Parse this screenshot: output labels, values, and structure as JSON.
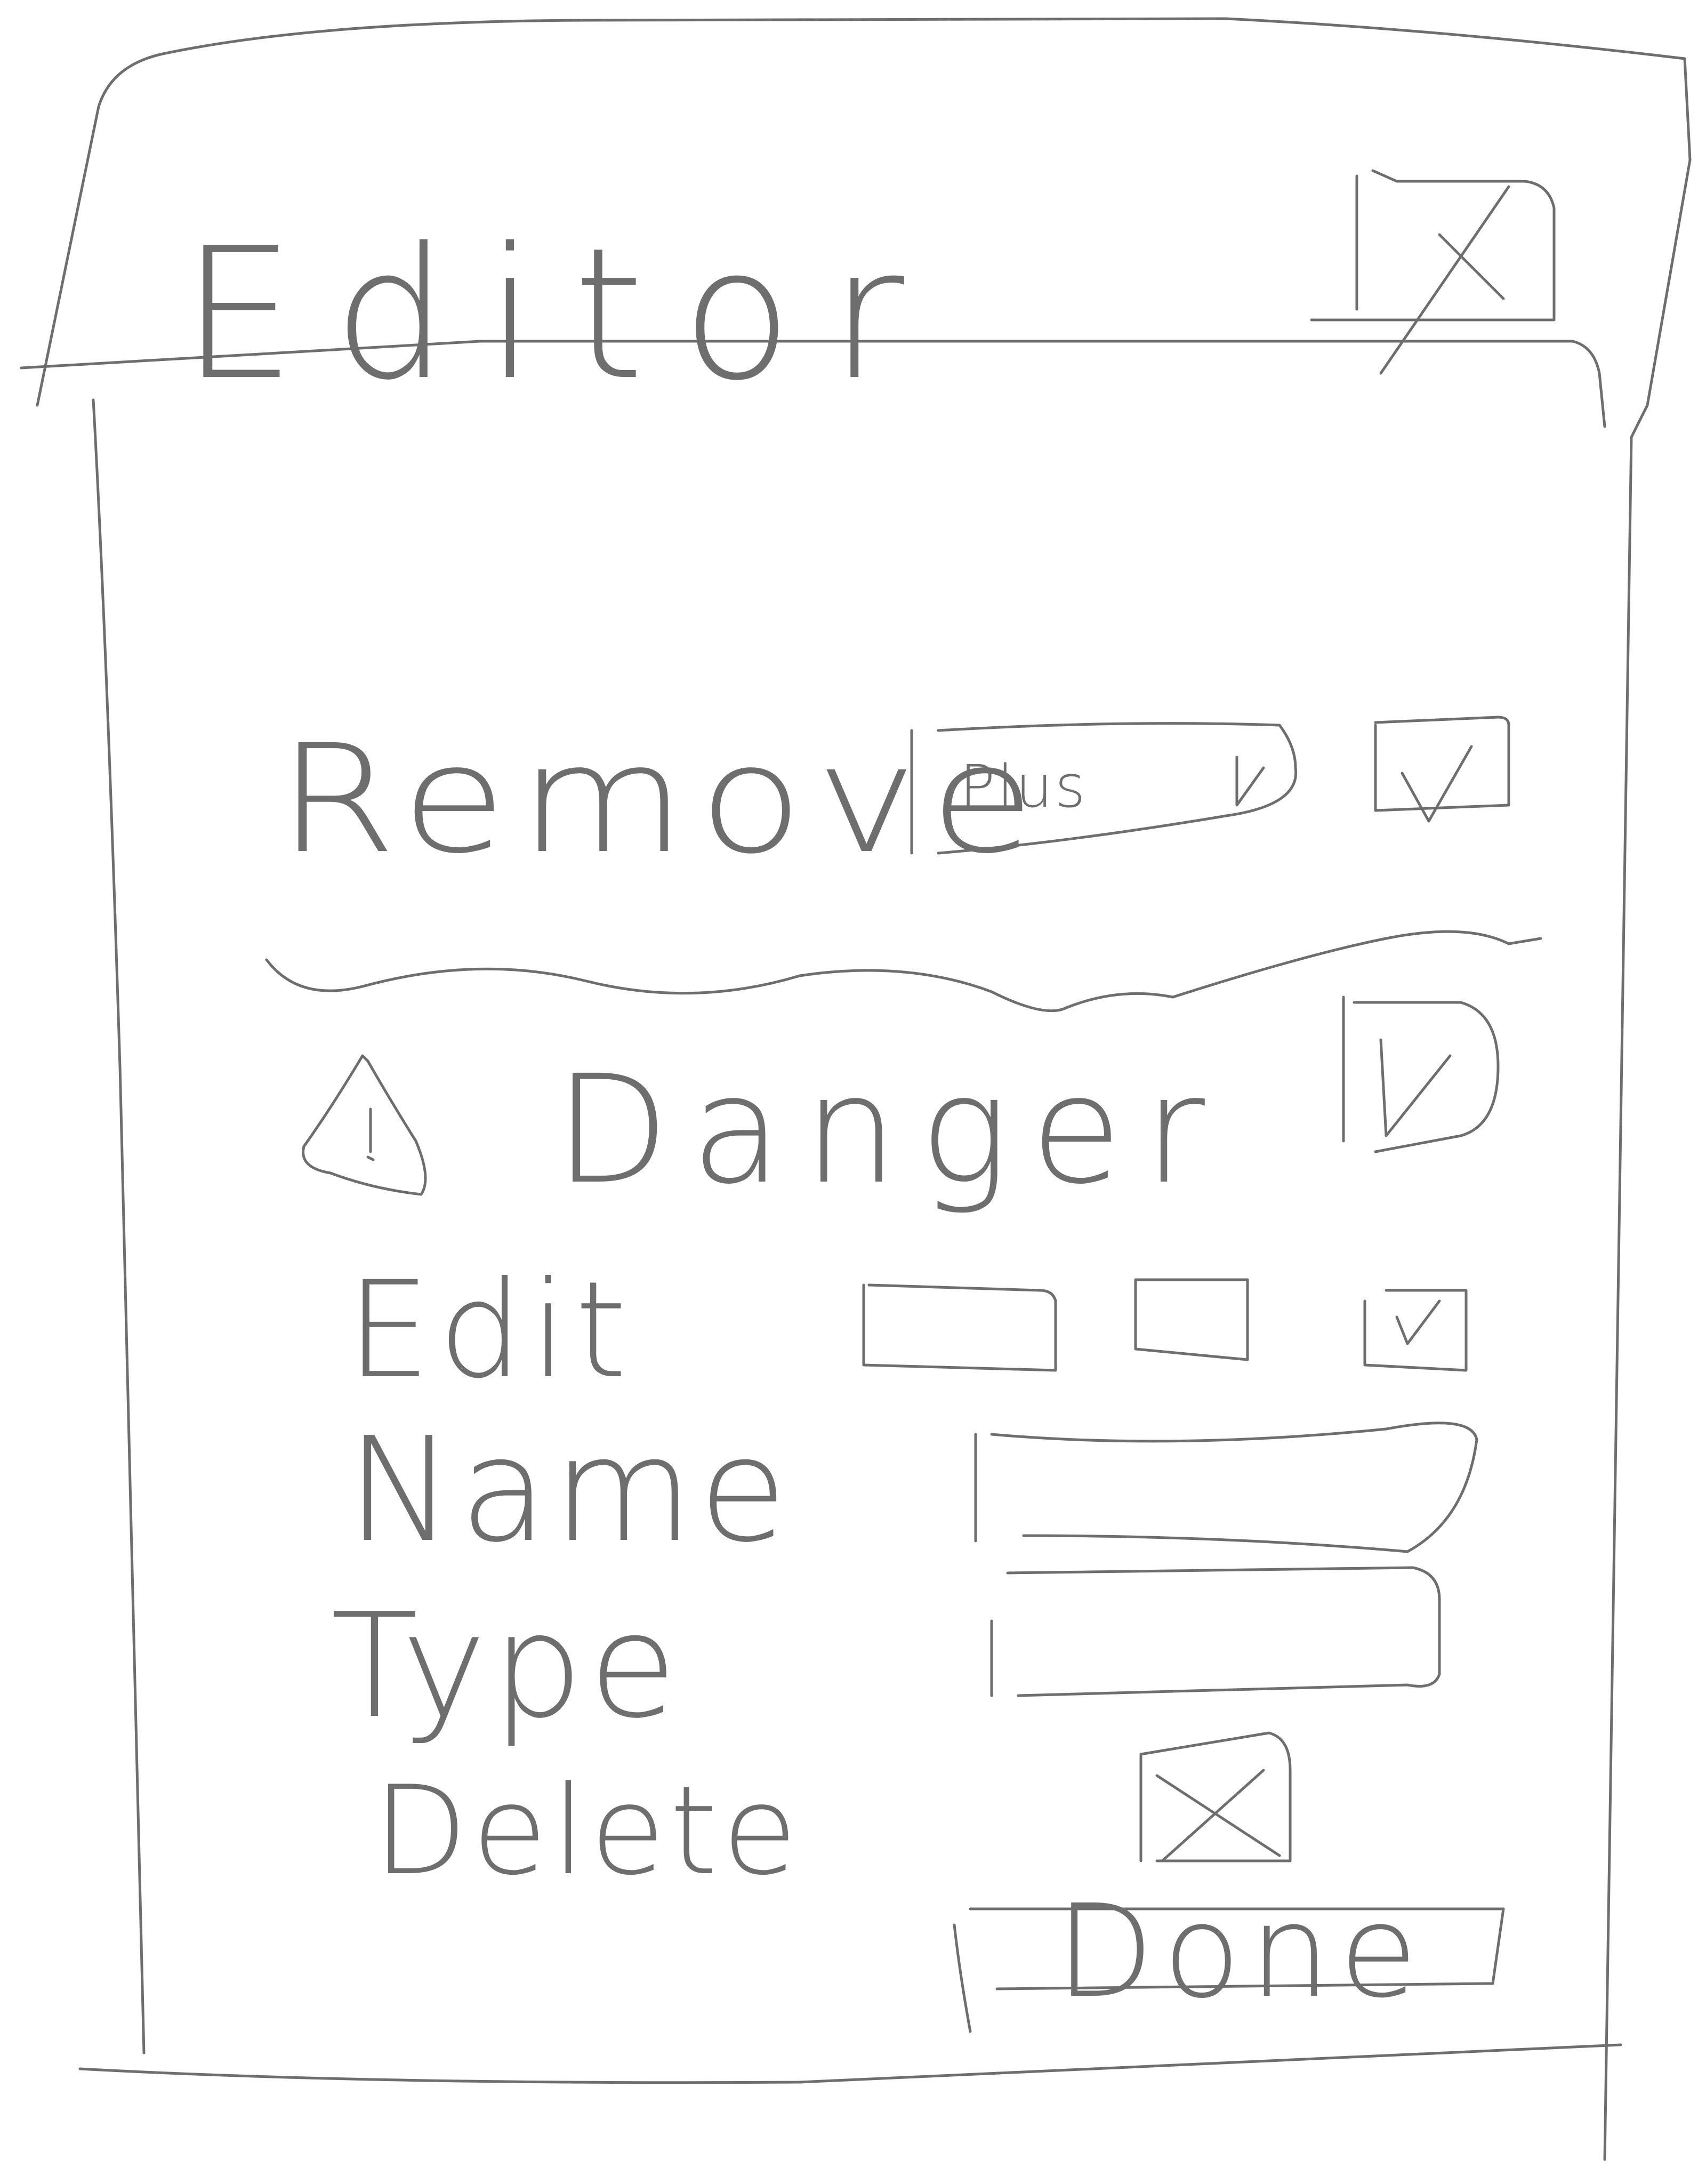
{
  "dialog": {
    "title": "Editor",
    "close_icon": "close-x-icon"
  },
  "remove_row": {
    "label": "Remove",
    "dropdown_value": "Plus",
    "dropdown_icon": "chevron-down-icon",
    "checkbox_checked": true
  },
  "danger_section": {
    "icon": "warning-triangle-icon",
    "label": "Danger",
    "checkbox_checked": true
  },
  "edit_row": {
    "label": "Edit",
    "checkbox_checked": true
  },
  "name_field": {
    "label": "Name",
    "value": ""
  },
  "type_field": {
    "label": "Type",
    "value": ""
  },
  "delete_row": {
    "label": "Delete",
    "icon": "close-x-icon"
  },
  "done_button": {
    "label": "Done"
  },
  "colors": {
    "stroke": "#6e6e6e",
    "background": "#ffffff"
  }
}
